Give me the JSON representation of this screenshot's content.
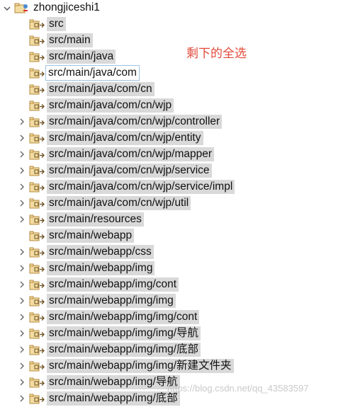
{
  "project": {
    "name": "zhongjiceshi1"
  },
  "annotation": "剩下的全选",
  "watermark": "https://blog.csdn.net/qq_43583597",
  "colors": {
    "highlight": "#d9d9d9",
    "selected_border": "#9ec3e8",
    "annotation": "#e24a3b"
  },
  "packages": [
    {
      "label": "src",
      "expandable": false,
      "selected": false
    },
    {
      "label": "src/main",
      "expandable": false,
      "selected": false
    },
    {
      "label": "src/main/java",
      "expandable": false,
      "selected": false
    },
    {
      "label": "src/main/java/com",
      "expandable": false,
      "selected": true
    },
    {
      "label": "src/main/java/com/cn",
      "expandable": false,
      "selected": false
    },
    {
      "label": "src/main/java/com/cn/wjp",
      "expandable": false,
      "selected": false
    },
    {
      "label": "src/main/java/com/cn/wjp/controller",
      "expandable": true,
      "selected": false
    },
    {
      "label": "src/main/java/com/cn/wjp/entity",
      "expandable": true,
      "selected": false
    },
    {
      "label": "src/main/java/com/cn/wjp/mapper",
      "expandable": true,
      "selected": false
    },
    {
      "label": "src/main/java/com/cn/wjp/service",
      "expandable": true,
      "selected": false
    },
    {
      "label": "src/main/java/com/cn/wjp/service/impl",
      "expandable": true,
      "selected": false
    },
    {
      "label": "src/main/java/com/cn/wjp/util",
      "expandable": true,
      "selected": false
    },
    {
      "label": "src/main/resources",
      "expandable": true,
      "selected": false
    },
    {
      "label": "src/main/webapp",
      "expandable": false,
      "selected": false
    },
    {
      "label": "src/main/webapp/css",
      "expandable": true,
      "selected": false
    },
    {
      "label": "src/main/webapp/img",
      "expandable": true,
      "selected": false
    },
    {
      "label": "src/main/webapp/img/cont",
      "expandable": true,
      "selected": false
    },
    {
      "label": "src/main/webapp/img/img",
      "expandable": true,
      "selected": false
    },
    {
      "label": "src/main/webapp/img/img/cont",
      "expandable": true,
      "selected": false
    },
    {
      "label": "src/main/webapp/img/img/导航",
      "expandable": true,
      "selected": false
    },
    {
      "label": "src/main/webapp/img/img/底部",
      "expandable": true,
      "selected": false
    },
    {
      "label": "src/main/webapp/img/img/新建文件夹",
      "expandable": true,
      "selected": false
    },
    {
      "label": "src/main/webapp/img/导航",
      "expandable": true,
      "selected": false
    },
    {
      "label": "src/main/webapp/img/底部",
      "expandable": true,
      "selected": false
    }
  ]
}
